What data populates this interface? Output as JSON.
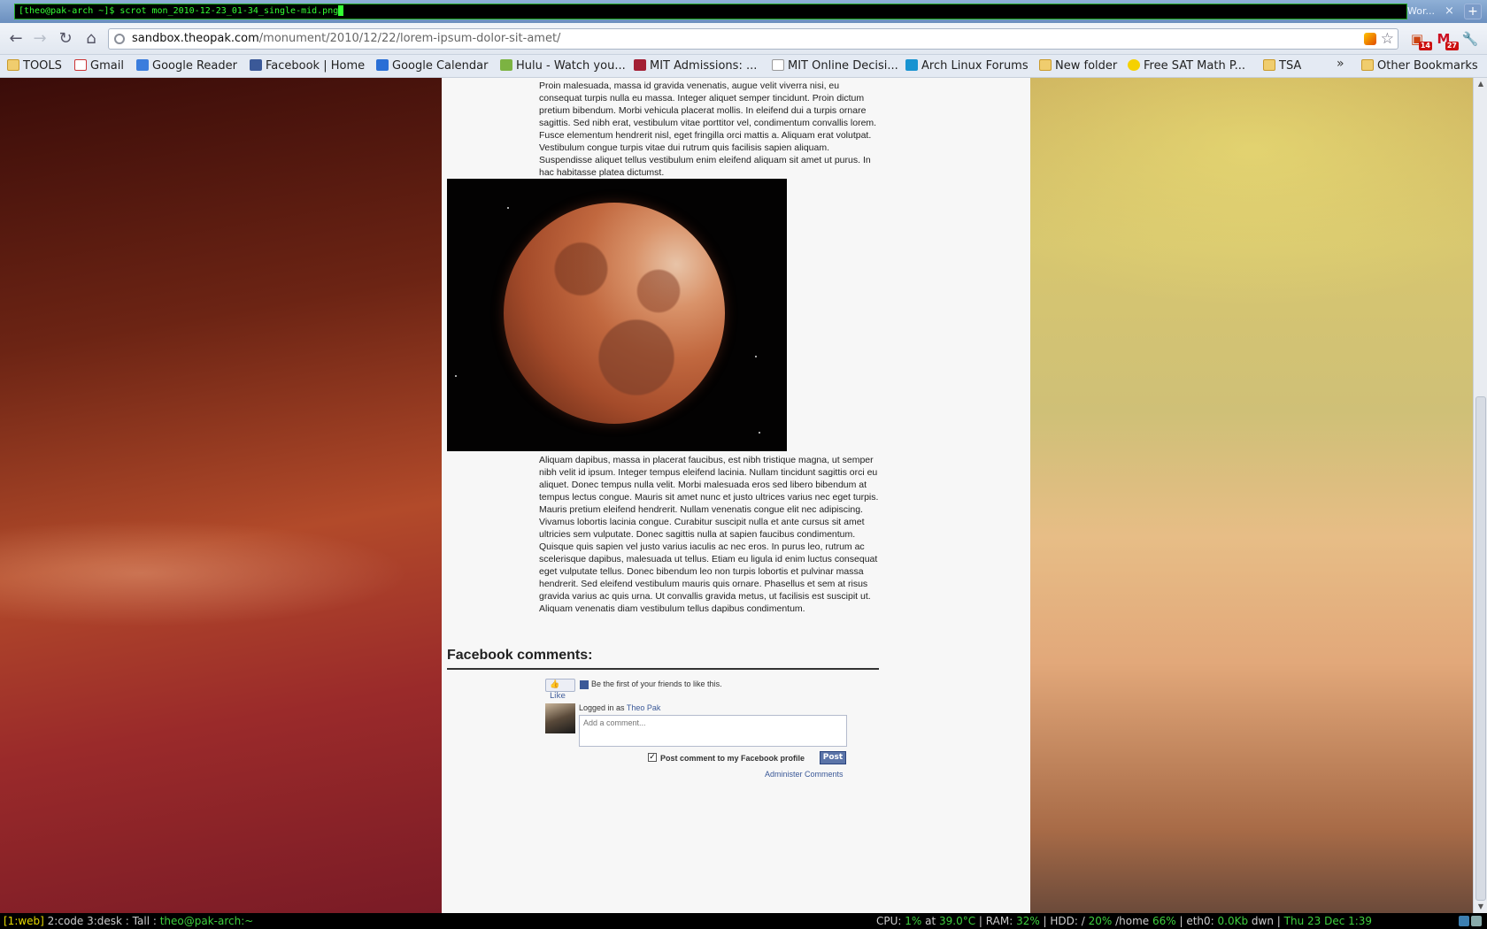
{
  "terminal": {
    "command": "[theo@pak-arch ~]$ scrot mon_2010-12-23_01-34_single-mid.png",
    "tab_title": "Wor...",
    "close_glyph": "×",
    "new_tab_glyph": "+"
  },
  "toolbar": {
    "back": "←",
    "forward": "→",
    "reload": "↻",
    "home": "⌂",
    "url_host": "sandbox.theopak.com",
    "url_path": "/monument/2010/12/22/lorem-ipsum-dolor-sit-amet/",
    "star": "☆",
    "ext_pdf_badge": "14",
    "ext_gmail_badge": "27",
    "wrench": "🔧"
  },
  "bookmarks": [
    {
      "label": "TOOLS",
      "icon": "folder-icon"
    },
    {
      "label": "Gmail",
      "icon": "gmail-icon"
    },
    {
      "label": "Google Reader",
      "icon": "reader-icon"
    },
    {
      "label": "Facebook | Home",
      "icon": "facebook-icon"
    },
    {
      "label": "Google Calendar",
      "icon": "calendar-icon"
    },
    {
      "label": "Hulu - Watch you...",
      "icon": "hulu-icon"
    },
    {
      "label": "MIT Admissions: ...",
      "icon": "mit-icon"
    },
    {
      "label": "MIT Online Decisi...",
      "icon": "document-icon"
    },
    {
      "label": "Arch Linux Forums",
      "icon": "arch-icon"
    },
    {
      "label": "New folder",
      "icon": "folder-icon"
    },
    {
      "label": "Free SAT Math P...",
      "icon": "sat-icon"
    },
    {
      "label": "TSA",
      "icon": "folder-icon"
    }
  ],
  "bookmarks_more": "»",
  "other_bookmarks": "Other Bookmarks",
  "article": {
    "para1": "Proin malesuada, massa id gravida venenatis, augue velit viverra nisi, eu consequat turpis nulla eu massa. Integer aliquet semper tincidunt. Proin dictum pretium bibendum. Morbi vehicula placerat mollis. In eleifend dui a turpis ornare sagittis. Sed nibh erat, vestibulum vitae porttitor vel, condimentum convallis lorem. Fusce elementum hendrerit nisl, eget fringilla orci mattis a. Aliquam erat volutpat. Vestibulum congue turpis vitae dui rutrum quis facilisis sapien aliquam. Suspendisse aliquet tellus vestibulum enim eleifend aliquam sit amet ut purus. In hac habitasse platea dictumst.",
    "para2": "Aliquam dapibus, massa in placerat faucibus, est nibh tristique magna, ut semper nibh velit id ipsum. Integer tempus eleifend lacinia. Nullam tincidunt sagittis orci eu aliquet. Donec tempus nulla velit. Morbi malesuada eros sed libero bibendum at tempus lectus congue. Mauris sit amet nunc et justo ultrices varius nec eget turpis. Mauris pretium eleifend hendrerit. Nullam venenatis congue elit nec adipiscing. Vivamus lobortis lacinia congue. Curabitur suscipit nulla et ante cursus sit amet ultricies sem vulputate. Donec sagittis nulla at sapien faucibus condimentum. Quisque quis sapien vel justo varius iaculis ac nec eros. In purus leo, rutrum ac scelerisque dapibus, malesuada ut tellus. Etiam eu ligula id enim luctus consequat eget vulputate tellus. Donec bibendum leo non turpis lobortis et pulvinar massa hendrerit. Sed eleifend vestibulum mauris quis ornare. Phasellus et sem at risus gravida varius ac quis urna. Ut convallis gravida metus, ut facilisis est suscipit ut. Aliquam venenatis diam vestibulum tellus dapibus condimentum."
  },
  "comments": {
    "heading": "Facebook comments:",
    "like_label": "Like",
    "like_text": "Be the first of your friends to like this.",
    "logged_in_prefix": "Logged in as ",
    "user": "Theo Pak",
    "placeholder": "Add a comment...",
    "post_to_profile": "Post comment to my Facebook profile",
    "post_button": "Post",
    "admin_link": "Administer Comments",
    "checkbox_checked": "✓"
  },
  "statusbar": {
    "ws_current": "[1:web]",
    "ws_others": " 2:code 3:desk : Tall : ",
    "ws_user": "theo@pak-arch:~",
    "cpu_label": "CPU: ",
    "cpu": "1%",
    "cpu_at": " at ",
    "temp": "39.0°C",
    "ram_label": " | RAM: ",
    "ram": "32%",
    "hdd_label": " | HDD: / ",
    "hdd_root": "20%",
    "hdd_home_label": " /home ",
    "hdd_home": "66%",
    "net_label": " | eth0: ",
    "net": "0.0Kb",
    "net_dir": " dwn",
    "sep": " | ",
    "datetime": "Thu 23 Dec  1:39"
  }
}
